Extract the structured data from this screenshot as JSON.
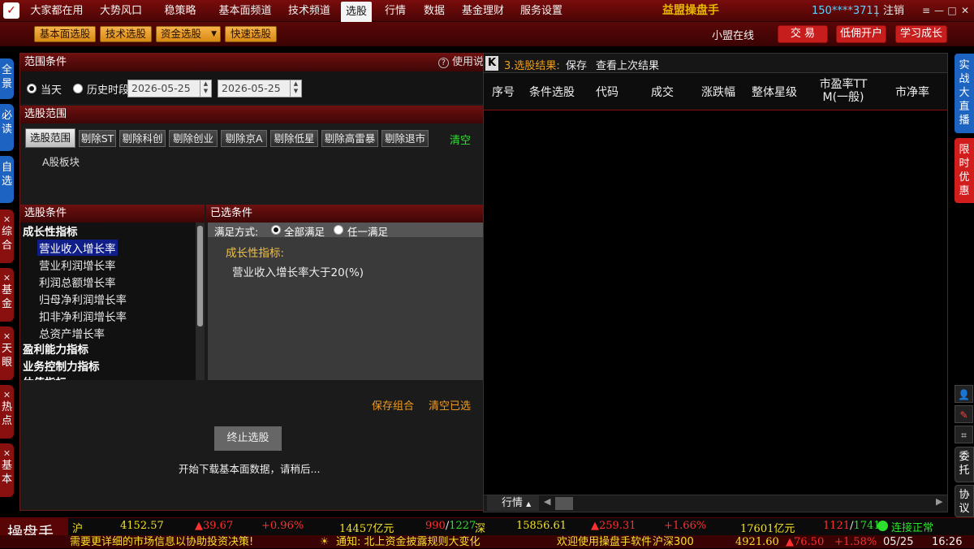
{
  "topnav": {
    "items": [
      "大家都在用",
      "大势风口",
      "稳策略",
      "基本面频道",
      "技术频道",
      "选股",
      "行情",
      "数据",
      "基金理财",
      "服务设置"
    ],
    "active": "选股",
    "app_title": "益盟操盘手",
    "account": "150****3711",
    "separator": "|",
    "logout": "注销"
  },
  "subnav": {
    "buttons": [
      "基本面选股",
      "技术选股",
      "资金选股",
      "快速选股"
    ],
    "online": "小盟在线",
    "actions": [
      "交 易",
      "低佣开户",
      "学习成长"
    ]
  },
  "left_tabs": [
    {
      "label": "全景",
      "closable": false,
      "color": "blue"
    },
    {
      "label": "必读",
      "closable": false,
      "color": "blue"
    },
    {
      "label": "自选",
      "closable": false,
      "color": "blue"
    },
    {
      "label": "综合",
      "closable": true,
      "color": "red"
    },
    {
      "label": "基金",
      "closable": true,
      "color": "red"
    },
    {
      "label": "天眼",
      "closable": true,
      "color": "red"
    },
    {
      "label": "热点",
      "closable": true,
      "color": "red"
    },
    {
      "label": "基本",
      "closable": true,
      "color": "red"
    }
  ],
  "range": {
    "title": "范围条件",
    "help": "使用说明",
    "help_icon": "?",
    "today": "当天",
    "history": "历史时段",
    "date_from": "2026-05-25",
    "date_to": "2026-05-25"
  },
  "scope": {
    "title": "选股范围",
    "buttons": [
      "选股范围",
      "剔除ST",
      "剔除科创",
      "剔除创业",
      "剔除京A",
      "剔除低星",
      "剔除高雷暴",
      "剔除退市"
    ],
    "clear": "清空",
    "board": "A股板块"
  },
  "conditions": {
    "title": "选股条件",
    "tree": [
      {
        "label": "成长性指标",
        "type": "cat"
      },
      {
        "label": "营业收入增长率",
        "type": "item",
        "selected": true
      },
      {
        "label": "营业利润增长率",
        "type": "item"
      },
      {
        "label": "利润总额增长率",
        "type": "item"
      },
      {
        "label": "归母净利润增长率",
        "type": "item"
      },
      {
        "label": "扣非净利润增长率",
        "type": "item"
      },
      {
        "label": "总资产增长率",
        "type": "item"
      },
      {
        "label": "盈利能力指标",
        "type": "cat"
      },
      {
        "label": "业务控制力指标",
        "type": "cat"
      },
      {
        "label": "估值指标",
        "type": "cat"
      }
    ]
  },
  "selected": {
    "title": "已选条件",
    "mode_label": "满足方式:",
    "mode_all": "全部满足",
    "mode_any": "任一满足",
    "group": "成长性指标:",
    "condition": "营业收入增长率大于20(%)"
  },
  "actions": {
    "save": "保存组合",
    "clear": "清空已选",
    "stop": "终止选股",
    "status": "开始下载基本面数据，请稍后..."
  },
  "results": {
    "k_icon": "K",
    "title": "3.选股结果:",
    "save": "保存",
    "last": "查看上次结果",
    "columns": [
      "序号",
      "条件选股",
      "代码",
      "成交",
      "涨跌幅",
      "整体星级",
      "市盈率TTM(一般)",
      "市净率"
    ],
    "footer_tab": "行情"
  },
  "right_tabs": [
    "实战大直播",
    "限时优惠"
  ],
  "right_tools": [
    "委托",
    "协议"
  ],
  "ticker": {
    "brand": "操盘手",
    "sh_label": "沪",
    "sh_index": "4152.57",
    "sh_change": "▲39.67",
    "sh_pct": "+0.96%",
    "sh_volume": "14457亿元",
    "sh_updown_up": "990",
    "sh_updown_down": "1227",
    "sz_label": "深",
    "sz_index": "15856.61",
    "sz_change": "▲259.31",
    "sz_pct": "+1.66%",
    "sz_volume": "17601亿元",
    "sz_updown_up": "1121",
    "sz_updown_down": "1741",
    "connection": "连接正常",
    "marquee1": "需要更详细的市场信息以协助投资决策!",
    "notice": "通知: 北上资金披露规则大变化",
    "marquee2": "欢迎使用操盘手软件",
    "idx300_label": "沪深300",
    "idx300_value": "4921.60",
    "idx300_change": "▲76.50",
    "idx300_pct": "+1.58%",
    "date": "05/25",
    "time": "16:26"
  },
  "colors": {
    "brand_red": "#7a0c0c",
    "accent_orange": "#f09a20",
    "link_blue": "#5fd0ff",
    "up_red": "#ff3030",
    "ok_green": "#2ee02e"
  }
}
